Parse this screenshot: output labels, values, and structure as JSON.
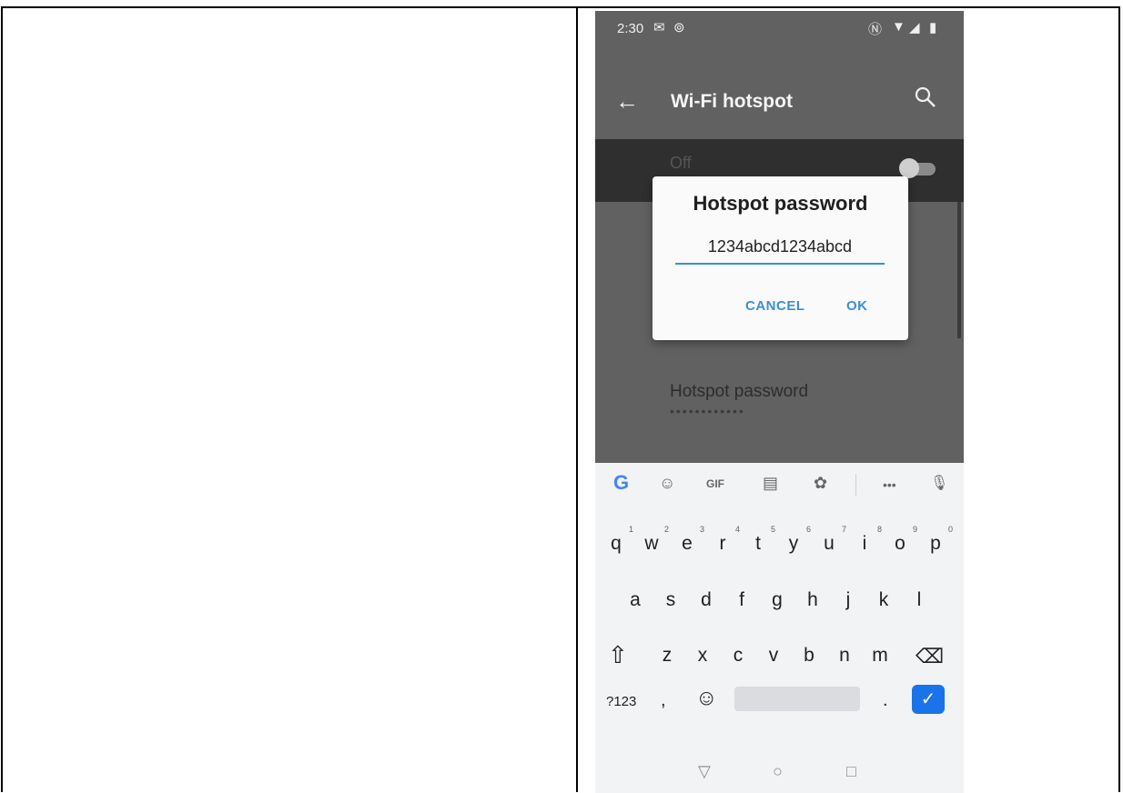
{
  "statusbar": {
    "time": "2:30",
    "left_icons": [
      "mail-icon",
      "sync-icon"
    ],
    "right_icons": [
      "nfc-icon",
      "wifi-icon",
      "signal-icon",
      "battery-icon"
    ]
  },
  "appbar": {
    "title": "Wi-Fi hotspot",
    "back_glyph": "←"
  },
  "background": {
    "switch_label": "Off",
    "password_row_label": "Hotspot password",
    "password_row_value": "••••••••••••"
  },
  "dialog": {
    "title": "Hotspot password",
    "input_value": "1234abcd1234abcd",
    "cancel_label": "CANCEL",
    "ok_label": "OK"
  },
  "keyboard": {
    "toolbar": {
      "google": "G",
      "sticker": "☺",
      "gif": "GIF",
      "clipboard": "▤",
      "settings": "✿",
      "more": "•••",
      "mic": "🎙"
    },
    "row1": [
      {
        "key": "q",
        "hint": "1"
      },
      {
        "key": "w",
        "hint": "2"
      },
      {
        "key": "e",
        "hint": "3"
      },
      {
        "key": "r",
        "hint": "4"
      },
      {
        "key": "t",
        "hint": "5"
      },
      {
        "key": "y",
        "hint": "6"
      },
      {
        "key": "u",
        "hint": "7"
      },
      {
        "key": "i",
        "hint": "8"
      },
      {
        "key": "o",
        "hint": "9"
      },
      {
        "key": "p",
        "hint": "0"
      }
    ],
    "row2": [
      "a",
      "s",
      "d",
      "f",
      "g",
      "h",
      "j",
      "k",
      "l"
    ],
    "row3": [
      "z",
      "x",
      "c",
      "v",
      "b",
      "n",
      "m"
    ],
    "shift": "⇧",
    "backspace": "⌫",
    "symbols": "?123",
    "comma": ",",
    "emoji": "☺",
    "period": ".",
    "enter": "✓"
  },
  "navbar": {
    "back": "▽",
    "home": "○",
    "recents": "□"
  },
  "colors": {
    "accent": "#3a8fd6",
    "enter": "#1a73e8",
    "scrim": "#616161"
  }
}
